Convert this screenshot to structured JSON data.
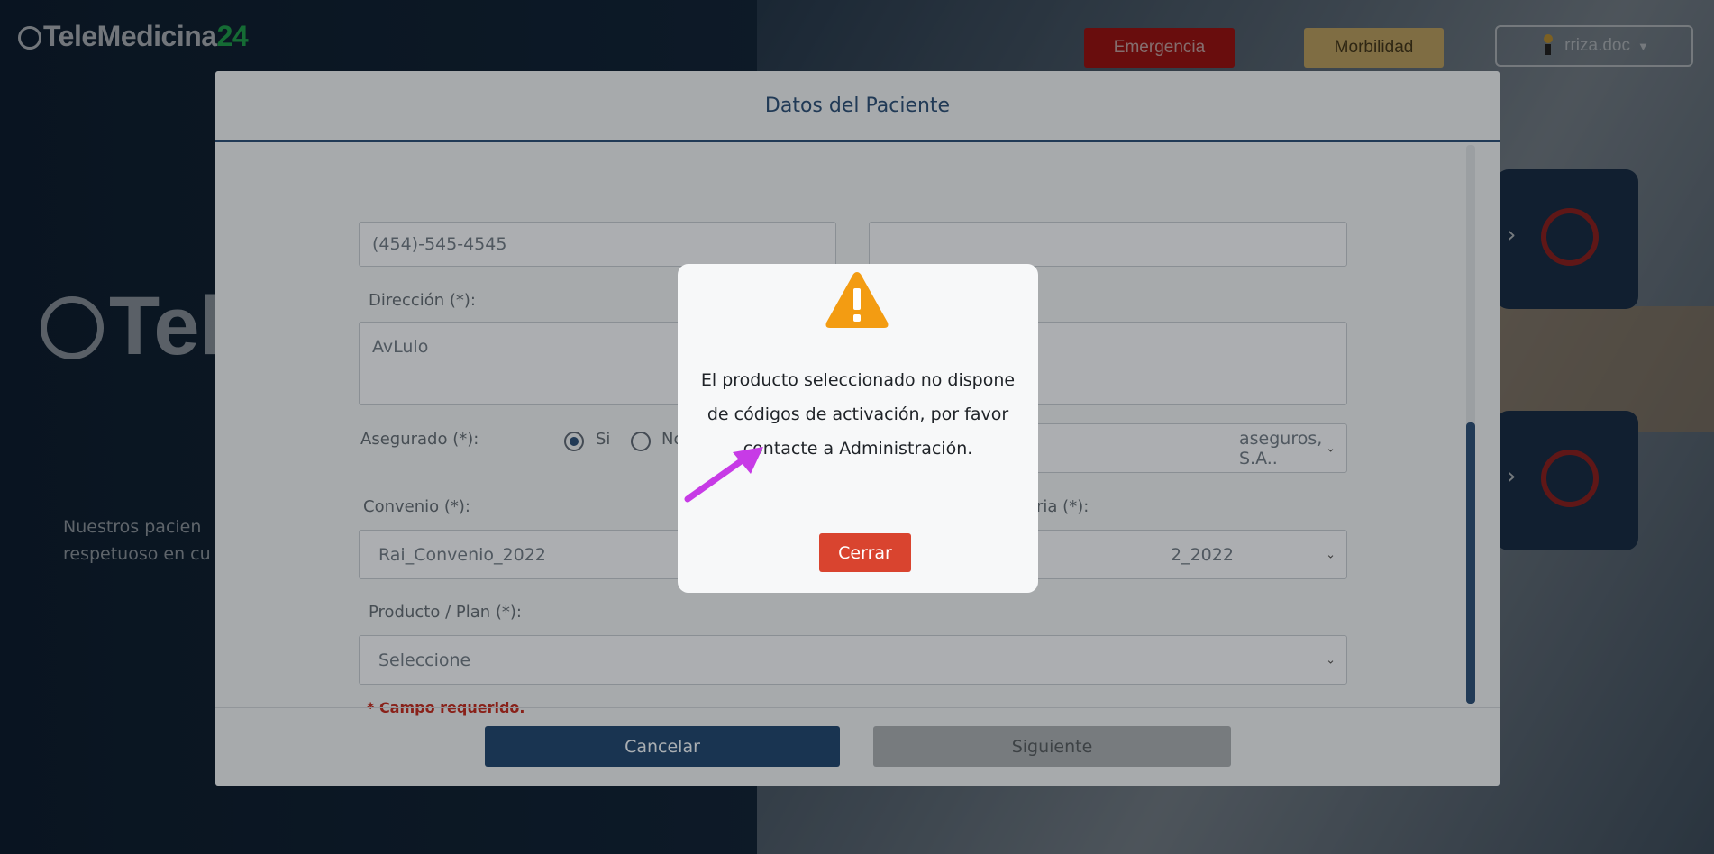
{
  "topbar": {
    "logo_main": "TeleMedicina",
    "logo_accent": "24",
    "emergency_label": "Emergencia",
    "morbidity_label": "Morbilidad",
    "user_label": "rriza.doc"
  },
  "background": {
    "big_logo": "Tele",
    "text_line1": "Nuestros pacien",
    "text_line2": "respetuoso en cu"
  },
  "modal": {
    "title": "Datos del Paciente",
    "phone_value": "(454)-545-4545",
    "address_label": "Dirección (*):",
    "address_value": "AvLulo",
    "insured_label": "Asegurado (*):",
    "insured_yes": "Si",
    "insured_no": "No",
    "insurer_value": "aseguros, S.A..",
    "agreement_label": "Convenio (*):",
    "agreement_value": "Rai_Convenio_2022",
    "second_label_partial": "aria (*):",
    "second_value_partial": "2_2022",
    "product_label": "Producto / Plan (*):",
    "product_value": "Seleccione",
    "required_note": "* Campo requerido.",
    "cancel_label": "Cancelar",
    "next_label": "Siguiente"
  },
  "alert": {
    "message": "El producto seleccionado no dispone de códigos de activación, por favor contacte a Administración.",
    "close_label": "Cerrar"
  },
  "colors": {
    "primary": "#2c4e73",
    "emergency": "#c01818",
    "morbidity": "#e8c77a",
    "close_button": "#d9442f",
    "warning": "#f39c12",
    "arrow": "#c73be6"
  },
  "icons": {
    "warning": "warning-triangle-icon",
    "user": "user-avatar-icon",
    "caret": "caret-down-icon"
  }
}
